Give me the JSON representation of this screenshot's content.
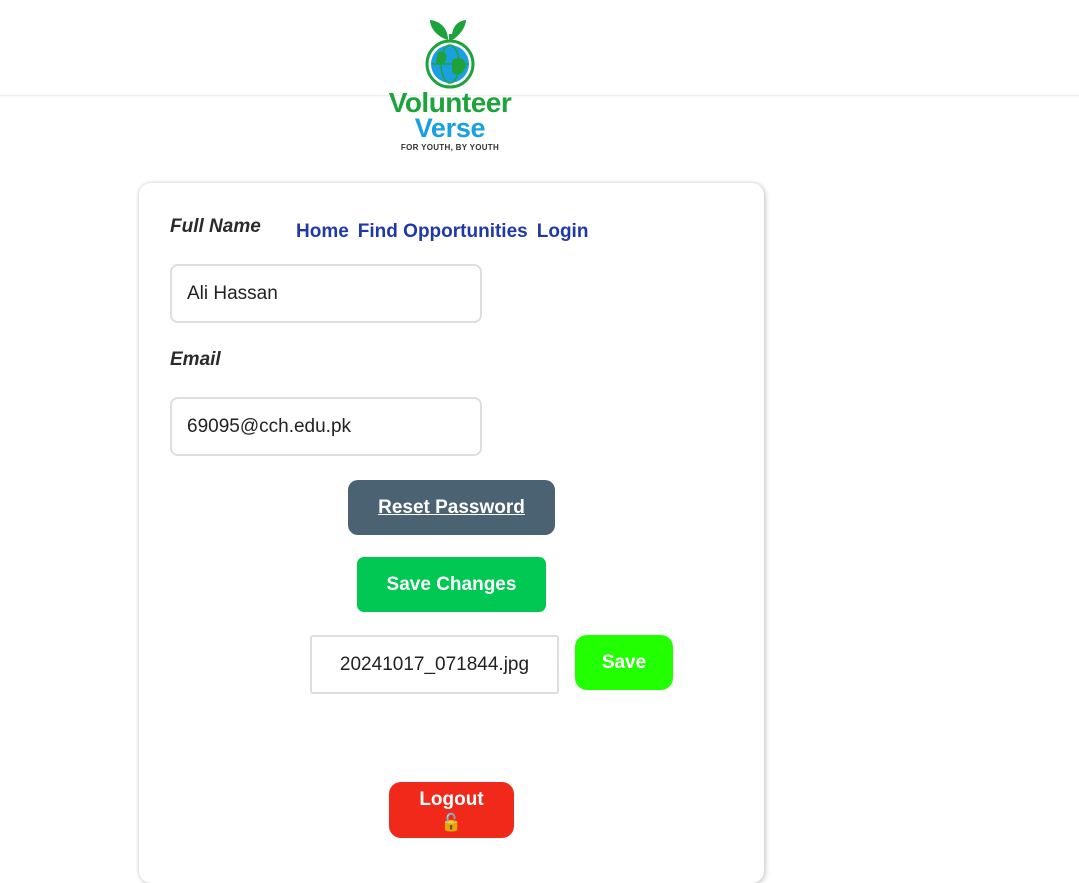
{
  "brand": {
    "name_line1": "Volunteer",
    "name_line2": "Verse",
    "tagline": "FOR YOUTH, BY YOUTH"
  },
  "nav": {
    "items": [
      {
        "label": "Home"
      },
      {
        "label": "Find Opportunities"
      },
      {
        "label": "Login"
      }
    ]
  },
  "form": {
    "full_name_label": "Full Name",
    "full_name_value": "Ali Hassan",
    "email_label": "Email",
    "email_value": "69095@cch.edu.pk",
    "reset_password_label": "Reset Password",
    "save_changes_label": "Save Changes",
    "file_name": "20241017_071844.jpg",
    "save_label": "Save",
    "logout_label": "Logout",
    "logout_icon_glyph": "🔓"
  },
  "colors": {
    "nav_link": "#1f3aa8",
    "reset_button": "#4a6272",
    "save_changes_button": "#00c853",
    "save_button": "#22ff00",
    "logout_button": "#f0291a",
    "brand_green": "#1ea33c",
    "brand_blue": "#1aa0e0"
  },
  "icons": {
    "logo": "globe-sprout-icon",
    "logout": "unlocked-padlock-icon"
  }
}
